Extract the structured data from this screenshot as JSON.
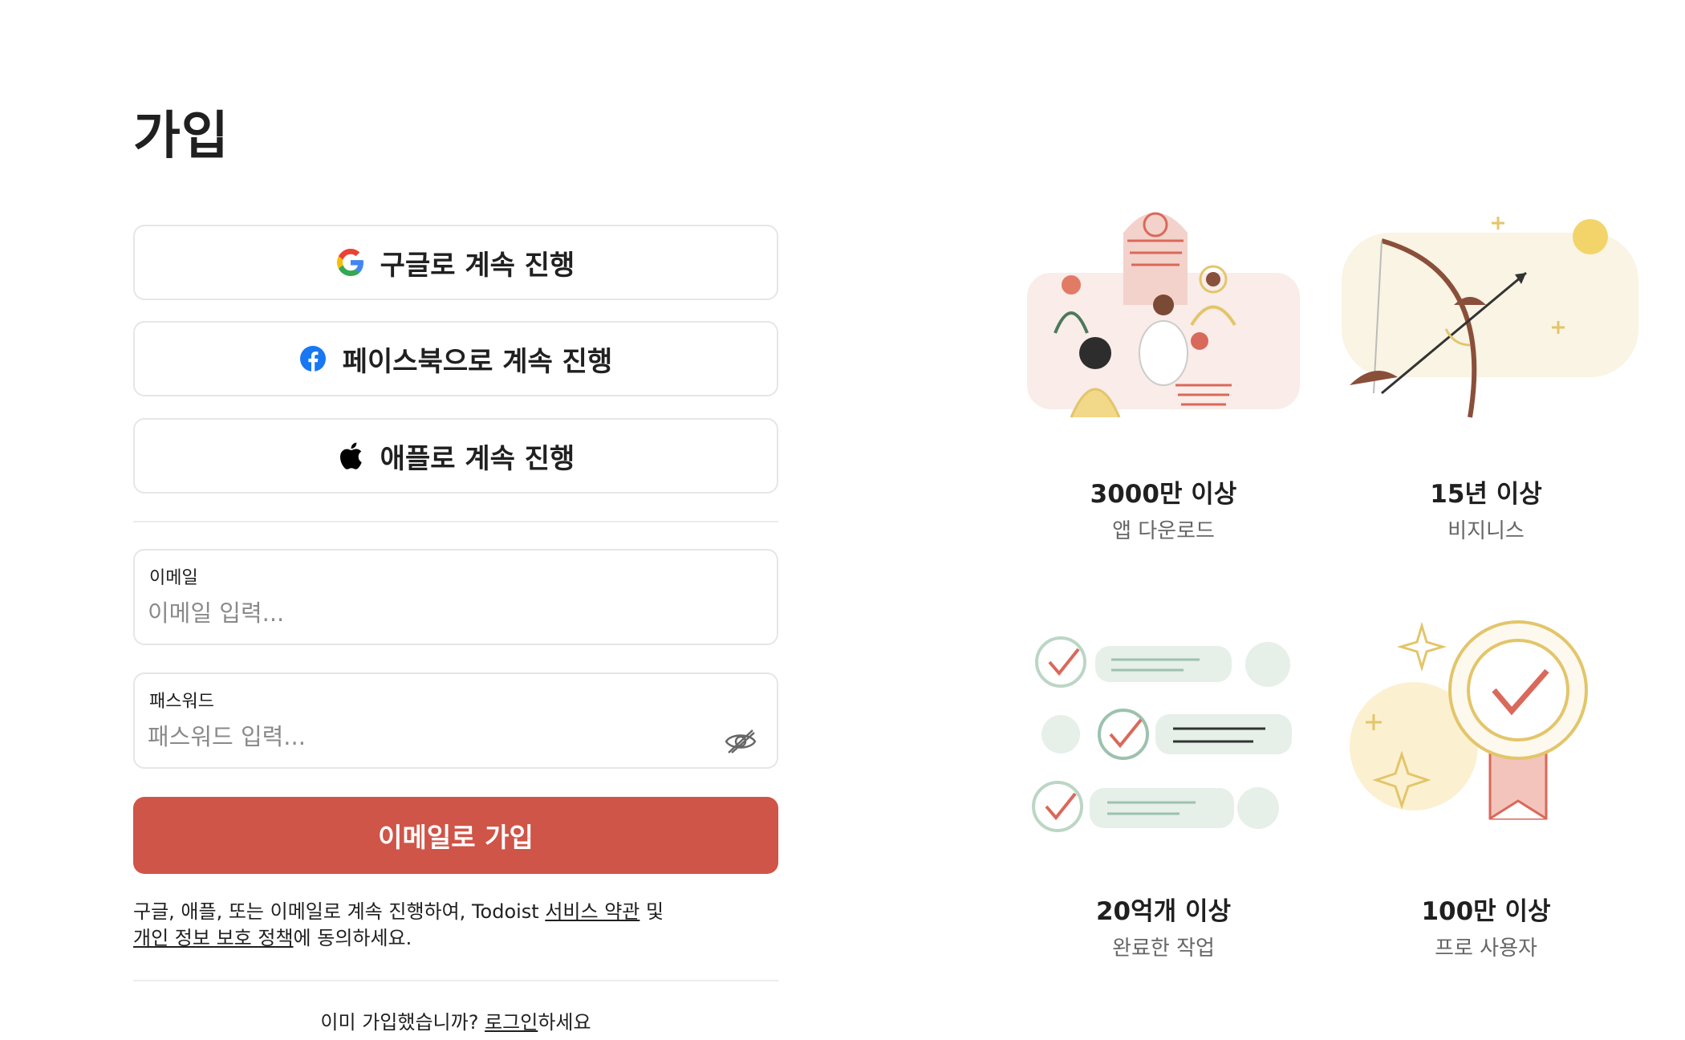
{
  "page": {
    "title": "가입"
  },
  "social": {
    "google_label": "구글로 계속 진행",
    "facebook_label": "페이스북으로 계속 진행",
    "apple_label": "애플로 계속 진행"
  },
  "form": {
    "email_label": "이메일",
    "email_placeholder": "이메일 입력...",
    "password_label": "패스워드",
    "password_placeholder": "패스워드 입력...",
    "submit_label": "이메일로 가입"
  },
  "terms": {
    "prefix": "구글, 애플, 또는 이메일로 계속 진행하여, Todoist ",
    "service_terms_link": "서비스 약관",
    "middle": " 및",
    "privacy_link": "개인 정보 보호 정책",
    "suffix": "에 동의하세요."
  },
  "login": {
    "prefix": "이미 가입했습니까? ",
    "link": "로그인",
    "suffix": "하세요"
  },
  "stats": [
    {
      "number": "3000만 이상",
      "caption": "앱 다운로드",
      "icon": "people-community-illustration"
    },
    {
      "number": "15년 이상",
      "caption": "비지니스",
      "icon": "bow-and-arrow-illustration"
    },
    {
      "number": "20억개 이상",
      "caption": "완료한 작업",
      "icon": "checklist-illustration"
    },
    {
      "number": "100만 이상",
      "caption": "프로 사용자",
      "icon": "award-badge-illustration"
    }
  ],
  "colors": {
    "accent": "#cf5548",
    "border": "#e6e6e6",
    "text": "#202020",
    "muted": "#666666"
  }
}
